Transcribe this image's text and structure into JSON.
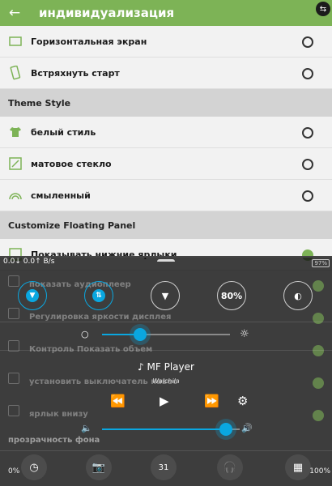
{
  "appbar": {
    "title": "индивидуализация",
    "back_icon": "arrow-left-icon"
  },
  "rows_top": [
    {
      "label": "Горизонтальная экран",
      "icon": "landscape-icon",
      "on": false
    },
    {
      "label": "Встряхнуть старт",
      "icon": "shake-phone-icon",
      "on": false
    }
  ],
  "section_theme": "Theme Style",
  "rows_theme": [
    {
      "label": "белый стиль",
      "icon": "shirt-icon",
      "on": false
    },
    {
      "label": "матовое стекло",
      "icon": "frosted-glass-icon",
      "on": false
    },
    {
      "label": "смыленный",
      "icon": "rainbow-icon",
      "on": false
    }
  ],
  "section_panel": "Customize Floating Panel",
  "row_panel_first": {
    "label": "Показывать нижние ярлыки",
    "on": true
  },
  "ghost_rows": [
    {
      "label": "показать аудиоплеер"
    },
    {
      "label": "Регулировка яркости дисплея"
    },
    {
      "label": "Контроль Показать объем"
    },
    {
      "label": "установить выключатель навес"
    },
    {
      "label": "ярлык внизу"
    }
  ],
  "opacity_label": "прозрачность фона",
  "opacity_min": "0%",
  "opacity_max": "100%",
  "panel": {
    "net_down": "0.0",
    "net_up": "0.0",
    "net_unit": "B/s",
    "battery": "97%",
    "toggles": [
      {
        "name": "wifi",
        "active": true,
        "icon": "wifi-icon"
      },
      {
        "name": "data",
        "active": true,
        "icon": "data-transfer-icon"
      },
      {
        "name": "flashlight",
        "active": false,
        "icon": "flashlight-icon"
      },
      {
        "name": "brightness",
        "active": false,
        "label": "80%"
      },
      {
        "name": "rotate",
        "active": false,
        "icon": "auto-brightness-icon"
      }
    ],
    "brightness_level": 0.3,
    "volume_level": 0.9,
    "player_title": "MF Player",
    "player_sub": "Walchila",
    "accent": "#0aa7e0",
    "bottom_icons": [
      "clock-icon",
      "camera-icon",
      "calendar-icon",
      "headphones-icon",
      "gallery-icon"
    ],
    "calendar_day": "31"
  }
}
